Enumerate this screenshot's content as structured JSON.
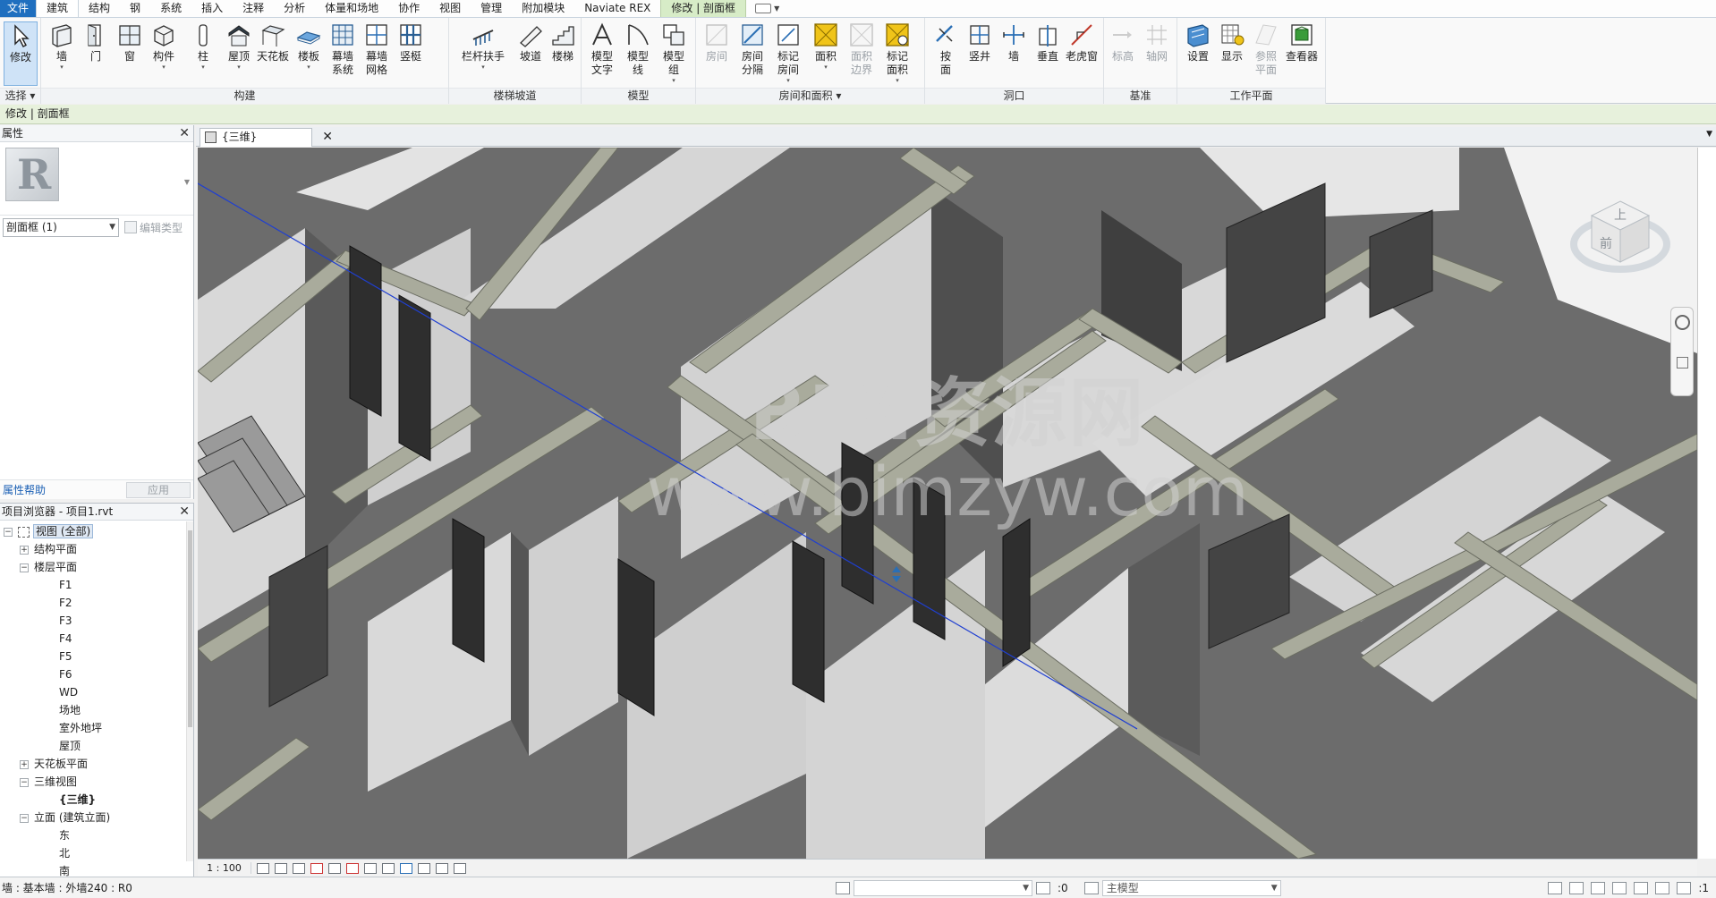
{
  "menu": {
    "tabs": [
      "文件",
      "建筑",
      "结构",
      "钢",
      "系统",
      "插入",
      "注释",
      "分析",
      "体量和场地",
      "协作",
      "视图",
      "管理",
      "附加模块",
      "Naviate REX",
      "修改 | 剖面框"
    ]
  },
  "ribbon": {
    "panels": {
      "select": "选择",
      "build": "构建",
      "stairs": "楼梯坡道",
      "model": "模型",
      "room": "房间和面积",
      "opening": "洞口",
      "datum": "基准",
      "workplane": "工作平面"
    },
    "buttons": {
      "modify": "修改",
      "wall": "墙",
      "door": "门",
      "window": "窗",
      "component": "构件",
      "column": "柱",
      "roof": "屋顶",
      "ceiling": "天花板",
      "floor": "楼板",
      "curtain_system": "幕墙\n系统",
      "curtain_grid": "幕墙\n网格",
      "mullion": "竖梃",
      "railing": "栏杆扶手",
      "ramp": "坡道",
      "stair": "楼梯",
      "model_text": "模型\n文字",
      "model_line": "模型\n线",
      "model_group": "模型\n组",
      "room": "房间",
      "room_separator": "房间\n分隔",
      "tag_room": "标记\n房间",
      "area": "面积",
      "area_boundary": "面积\n边界",
      "tag_area": "标记\n面积",
      "by_face": "按\n面",
      "shaft": "竖井",
      "wall_opening": "墙",
      "vertical": "垂直",
      "dormer": "老虎窗",
      "level": "标高",
      "grid": "轴网",
      "set": "设置",
      "show": "显示",
      "ref_plane": "参照\n平面",
      "viewer": "查看器"
    }
  },
  "optionbar": {
    "text": "修改 | 剖面框"
  },
  "properties": {
    "title": "属性",
    "type_value": "剖面框 (1)",
    "edit_type": "编辑类型",
    "help": "属性帮助",
    "apply": "应用"
  },
  "browser": {
    "title": "项目浏览器 - 项目1.rvt",
    "items": {
      "views_all": "视图 (全部)",
      "structural_plan": "结构平面",
      "floor_plan": "楼层平面",
      "f1": "F1",
      "f2": "F2",
      "f3": "F3",
      "f4": "F4",
      "f5": "F5",
      "f6": "F6",
      "wd": "WD",
      "site": "场地",
      "outdoor": "室外地坪",
      "roof": "屋顶",
      "ceiling_plan": "天花板平面",
      "view_3d": "三维视图",
      "view_3d_item": "{三维}",
      "elevation": "立面 (建筑立面)",
      "east": "东",
      "north": "北",
      "south": "南"
    }
  },
  "view": {
    "tab_label": "{三维}",
    "watermark_title": "BIM资源网",
    "watermark_url": "www.bimzyw.com",
    "viewcube_front": "前",
    "viewcube_top": "上",
    "scale": "1 : 100"
  },
  "status": {
    "text": "墙 : 基本墙 : 外墙240 : R0",
    "zero": ":0",
    "model": "主模型",
    "filter_count": ":1"
  }
}
